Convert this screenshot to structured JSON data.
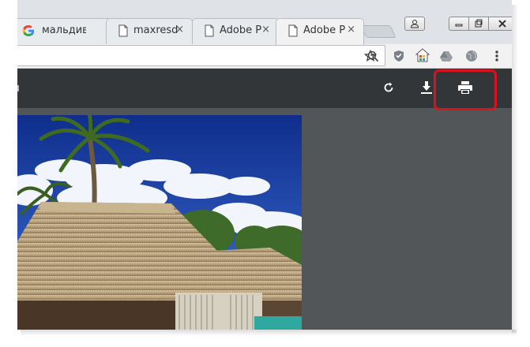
{
  "tabs": [
    {
      "label": "мальдив",
      "icon": "google-icon",
      "active": false
    },
    {
      "label": "maxresd",
      "icon": "page-icon",
      "active": false
    },
    {
      "label": "Adobe P",
      "icon": "page-icon",
      "active": false
    },
    {
      "label": "Adobe P",
      "icon": "page-icon",
      "active": true
    }
  ],
  "tab_close_glyph": "×",
  "window_controls": {
    "profile": "profile-icon",
    "minimize": "minimize-icon",
    "restore": "restore-icon",
    "close": "close-icon"
  },
  "toolbar": {
    "icons": [
      "zoom-icon",
      "star-icon",
      "shield-extension-icon",
      "apps-extension-icon",
      "drive-extension-icon",
      "globe-extension-icon",
      "menu-icon"
    ]
  },
  "pdf_viewer": {
    "left_fragment": "ı",
    "controls": [
      "rotate-icon",
      "download-icon",
      "print-icon"
    ],
    "highlighted_control": "print-icon",
    "colors": {
      "toolbar": "#323639",
      "background": "#525659",
      "highlight": "#d8121f"
    }
  }
}
